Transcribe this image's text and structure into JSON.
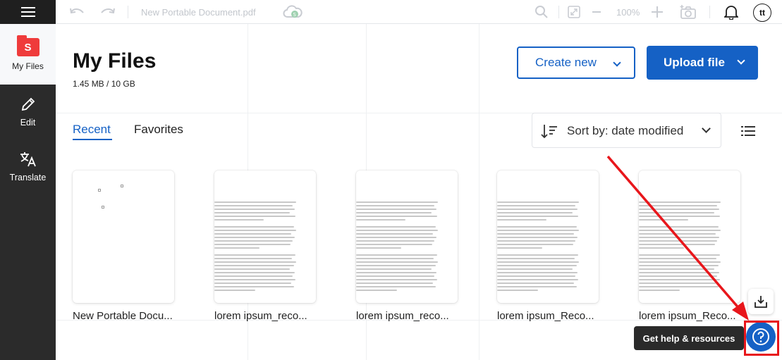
{
  "toolbar": {
    "menu_icon": "hamburger-icon",
    "undo_icon": "undo-icon",
    "redo_icon": "redo-icon",
    "document_title": "New Portable Document.pdf",
    "cloud_icon": "cloud-save-icon",
    "zoom_level": "100%",
    "avatar_initials": "tt"
  },
  "sidebar": {
    "items": [
      {
        "label": "My Files",
        "icon": "folder-icon",
        "icon_text": "S"
      },
      {
        "label": "Edit",
        "icon": "pencil-icon"
      },
      {
        "label": "Translate",
        "icon": "translate-icon"
      }
    ]
  },
  "main": {
    "title": "My Files",
    "storage": "1.45 MB / 10 GB",
    "create_new_label": "Create new",
    "upload_file_label": "Upload file",
    "tabs": [
      {
        "label": "Recent",
        "active": true
      },
      {
        "label": "Favorites",
        "active": false
      }
    ],
    "sort_label": "Sort by: date modified"
  },
  "files": [
    {
      "name": "New Portable Docu..."
    },
    {
      "name": "lorem ipsum_reco..."
    },
    {
      "name": "lorem ipsum_reco..."
    },
    {
      "name": "lorem ipsum_Reco..."
    },
    {
      "name": "lorem ipsum_Reco..."
    }
  ],
  "help": {
    "tooltip": "Get help & resources",
    "icon": "help-question-icon"
  },
  "colors": {
    "brand_blue": "#1561c5",
    "sidebar_dark": "#2b2b2b",
    "folder_red": "#ef3b3b",
    "annotation_red": "#e8161b"
  }
}
